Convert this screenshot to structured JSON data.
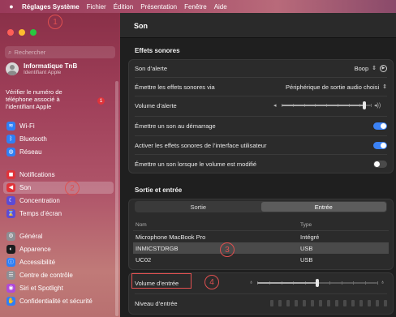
{
  "menubar": {
    "apple": "",
    "app": "Réglages Système",
    "items": [
      "Fichier",
      "Édition",
      "Présentation",
      "Fenêtre",
      "Aide"
    ]
  },
  "sidebar": {
    "search_placeholder": "Rechercher",
    "account_name": "Informatique TnB",
    "account_sub": "Identifiant Apple",
    "verify_text": "Vérifier le numéro de téléphone associé à l’identifiant Apple",
    "verify_badge": "1",
    "items": [
      {
        "label": "Wi-Fi",
        "icon": "wifi-icon",
        "color": "#2f7ff5",
        "glyph": "≋"
      },
      {
        "label": "Bluetooth",
        "icon": "bluetooth-icon",
        "color": "#2f7ff5",
        "glyph": "ᛒ"
      },
      {
        "label": "Réseau",
        "icon": "network-icon",
        "color": "#2f7ff5",
        "glyph": "◍"
      },
      {
        "label": "Notifications",
        "icon": "bell-icon",
        "color": "#e0333a",
        "glyph": "◼"
      },
      {
        "label": "Son",
        "icon": "speaker-icon",
        "color": "#e0333a",
        "glyph": "◀"
      },
      {
        "label": "Concentration",
        "icon": "moon-icon",
        "color": "#5c4bd6",
        "glyph": "☾"
      },
      {
        "label": "Temps d’écran",
        "icon": "hourglass-icon",
        "color": "#5c4bd6",
        "glyph": "⌛"
      },
      {
        "label": "Général",
        "icon": "gear-icon",
        "color": "#8e8e93",
        "glyph": "⚙"
      },
      {
        "label": "Apparence",
        "icon": "appearance-icon",
        "color": "#1c1c1e",
        "glyph": "◐"
      },
      {
        "label": "Accessibilité",
        "icon": "accessibility-icon",
        "color": "#2f7ff5",
        "glyph": "ⓘ"
      },
      {
        "label": "Centre de contrôle",
        "icon": "control-center-icon",
        "color": "#8e8e93",
        "glyph": "☰"
      },
      {
        "label": "Siri et Spotlight",
        "icon": "siri-icon",
        "color": "#b04ad8",
        "glyph": "◉"
      },
      {
        "label": "Confidentialité et sécurité",
        "icon": "hand-icon",
        "color": "#2f7ff5",
        "glyph": "✋"
      }
    ]
  },
  "main": {
    "title": "Son",
    "effects_title": "Effets sonores",
    "alert_sound_label": "Son d’alerte",
    "alert_sound_value": "Boop",
    "play_effects_label": "Émettre les effets sonores via",
    "play_effects_value": "Périphérique de sortie audio choisi",
    "alert_volume_label": "Volume d’alerte",
    "alert_volume_level": 0.93,
    "startup_label": "Émettre un son au démarrage",
    "startup_on": true,
    "ui_effects_label": "Activer les effets sonores de l’interface utilisateur",
    "ui_effects_on": true,
    "volume_feedback_label": "Émettre un son lorsque le volume est modifié",
    "volume_feedback_on": false,
    "io_title": "Sortie et entrée",
    "tab_output": "Sortie",
    "tab_input": "Entrée",
    "col_name": "Nom",
    "col_type": "Type",
    "devices": [
      {
        "name": "Microphone MacBook Pro",
        "type": "Intégré"
      },
      {
        "name": "INMICSTDRGB",
        "type": "USB"
      },
      {
        "name": "UC02",
        "type": "USB"
      }
    ],
    "input_volume_label": "Volume d’entrée",
    "input_volume_level": 0.5,
    "input_level_label": "Niveau d’entrée"
  },
  "annotations": [
    "1",
    "2",
    "3",
    "4"
  ]
}
